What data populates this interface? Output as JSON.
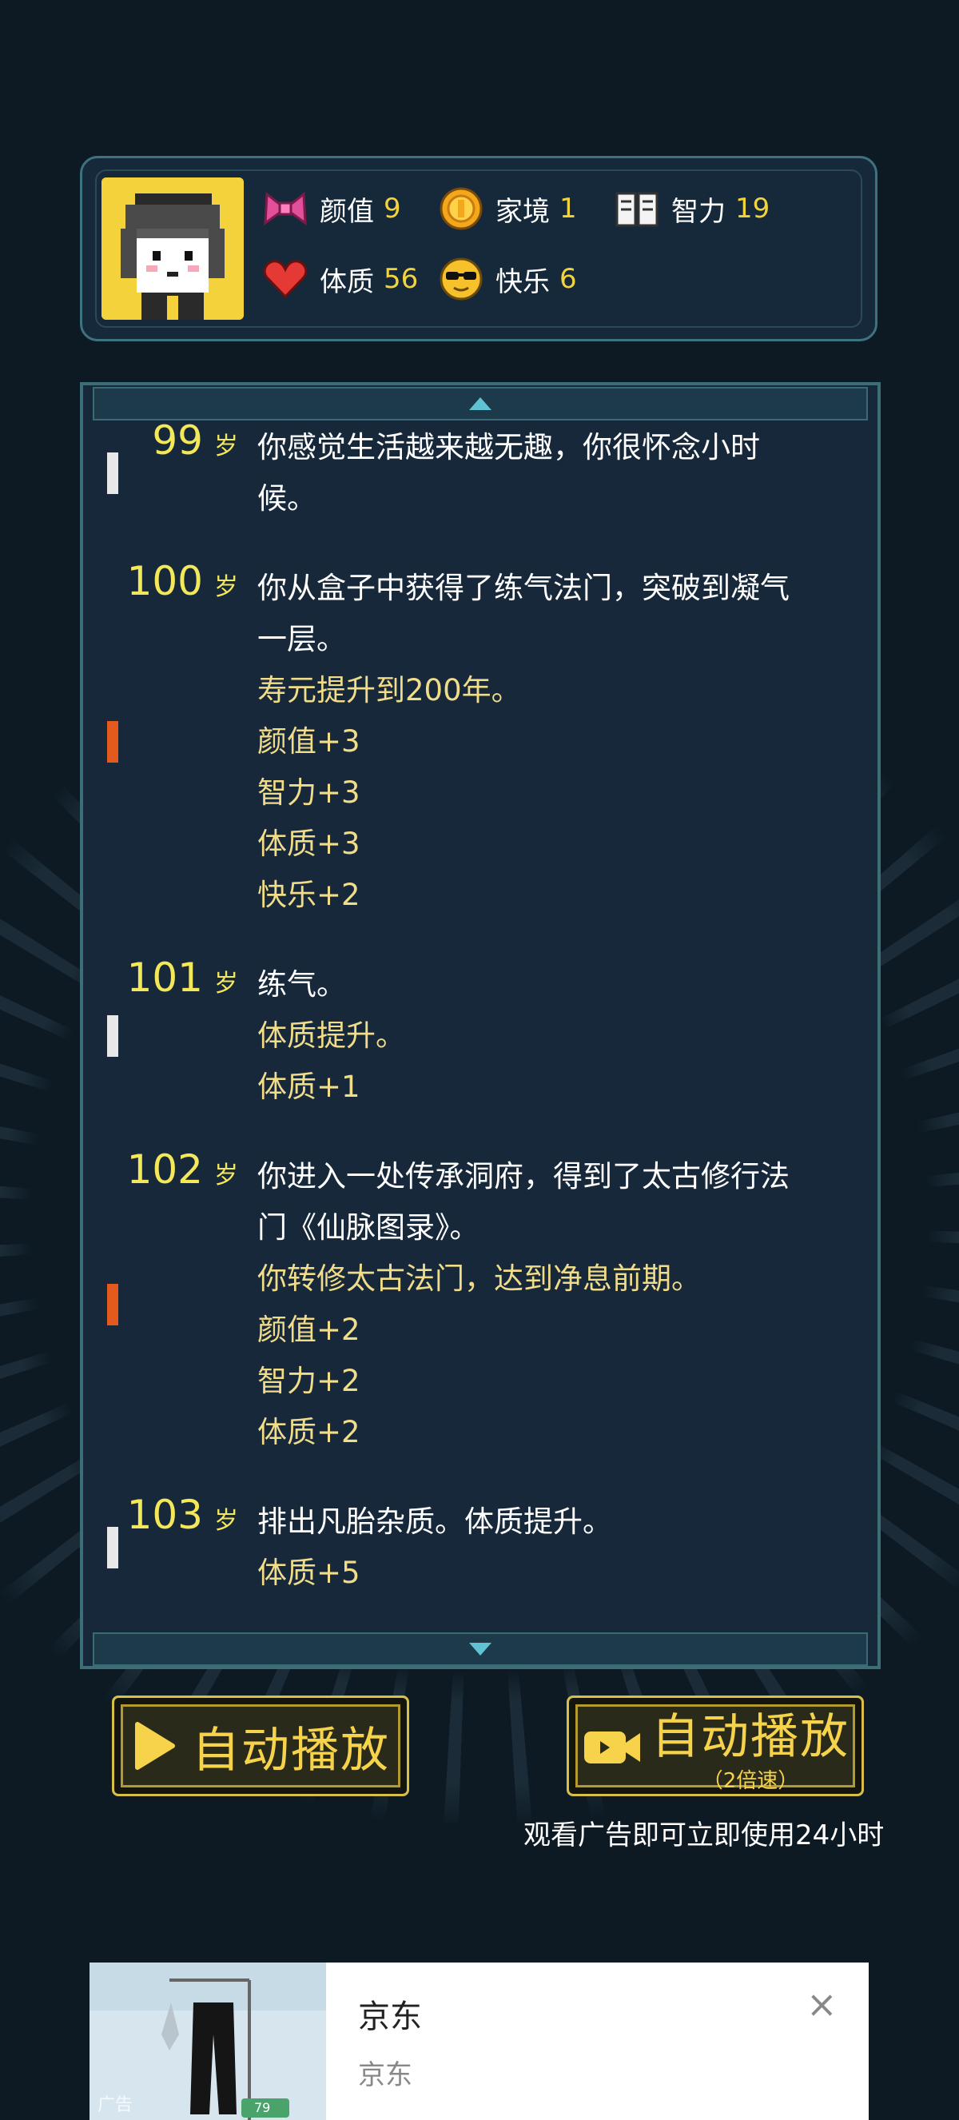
{
  "stats": {
    "appearance": {
      "label": "颜值",
      "value": "9"
    },
    "family": {
      "label": "家境",
      "value": "1"
    },
    "intelligence": {
      "label": "智力",
      "value": "19"
    },
    "constitution": {
      "label": "体质",
      "value": "56"
    },
    "happiness": {
      "label": "快乐",
      "value": "6"
    }
  },
  "log": [
    {
      "age": "99",
      "unit": "岁",
      "marker": "#e8e8e8",
      "lines": [
        {
          "text": "你感觉生活越来越无趣，你很怀念小时",
          "c": "white"
        },
        {
          "text": "候。",
          "c": "white"
        }
      ]
    },
    {
      "age": "100",
      "unit": "岁",
      "marker": "#e25a1c",
      "lines": [
        {
          "text": "你从盒子中获得了练气法门，突破到凝气",
          "c": "white"
        },
        {
          "text": "一层。",
          "c": "white"
        },
        {
          "text": "寿元提升到200年。",
          "c": "gold"
        },
        {
          "text": "颜值+3",
          "c": "gold"
        },
        {
          "text": "智力+3",
          "c": "gold"
        },
        {
          "text": "体质+3",
          "c": "gold"
        },
        {
          "text": "快乐+2",
          "c": "gold"
        }
      ]
    },
    {
      "age": "101",
      "unit": "岁",
      "marker": "#e8e8e8",
      "lines": [
        {
          "text": "练气。",
          "c": "white"
        },
        {
          "text": "体质提升。",
          "c": "gold"
        },
        {
          "text": "体质+1",
          "c": "gold"
        }
      ]
    },
    {
      "age": "102",
      "unit": "岁",
      "marker": "#e25a1c",
      "lines": [
        {
          "text": "你进入一处传承洞府，得到了太古修行法",
          "c": "white"
        },
        {
          "text": "门《仙脉图录》。",
          "c": "white"
        },
        {
          "text": "你转修太古法门，达到净息前期。",
          "c": "gold"
        },
        {
          "text": "颜值+2",
          "c": "gold"
        },
        {
          "text": "智力+2",
          "c": "gold"
        },
        {
          "text": "体质+2",
          "c": "gold"
        }
      ]
    },
    {
      "age": "103",
      "unit": "岁",
      "marker": "#e8e8e8",
      "lines": [
        {
          "text": "排出凡胎杂质。体质提升。",
          "c": "white"
        },
        {
          "text": "体质+5",
          "c": "gold"
        }
      ]
    }
  ],
  "buttons": {
    "auto_play": "自动播放",
    "auto_play_fast": "自动播放",
    "auto_play_fast_sub": "（2倍速）",
    "ad_note": "观看广告即可立即使用24小时"
  },
  "ad": {
    "title": "京东",
    "source": "京东",
    "tag": "广告",
    "close": "×",
    "badge": "79"
  }
}
